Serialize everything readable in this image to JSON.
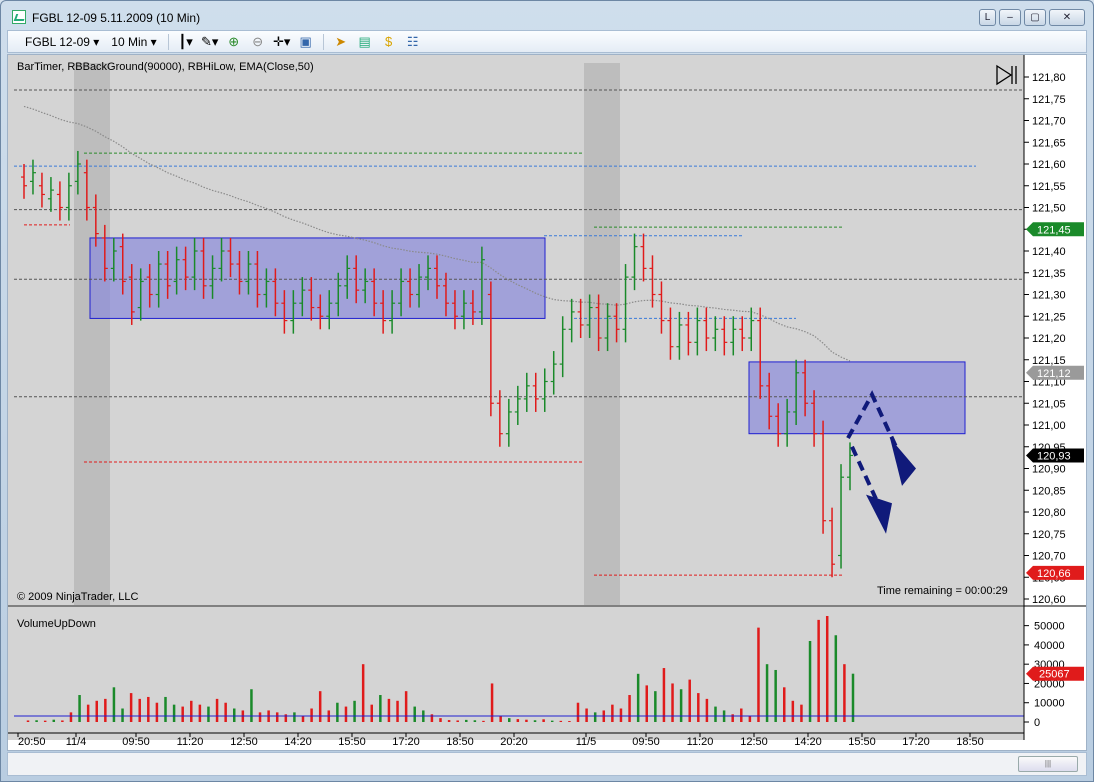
{
  "window": {
    "title": "FGBL 12-09  5.11.2009 (10 Min)",
    "buttons": [
      "L",
      "–",
      "▢",
      "✕"
    ]
  },
  "toolbar": {
    "instrument": "FGBL 12-09",
    "interval": "10 Min"
  },
  "price_panel": {
    "indicator_label": "BarTimer, RBBackGround(90000), RBHiLow, EMA(Close,50)",
    "copyright": "© 2009 NinjaTrader, LLC",
    "time_remaining": "Time remaining = 00:00:29",
    "y_ticks": [
      "121,80",
      "121,75",
      "121,70",
      "121,65",
      "121,60",
      "121,55",
      "121,50",
      "121,45",
      "121,40",
      "121,35",
      "121,30",
      "121,25",
      "121,20",
      "121,15",
      "121,10",
      "121,05",
      "121,00",
      "120,95",
      "120,90",
      "120,85",
      "120,80",
      "120,75",
      "120,70",
      "120,65",
      "120,60"
    ],
    "markers": [
      {
        "label": "121,45",
        "color": "#1a8a2a"
      },
      {
        "label": "121,12",
        "color": "#9a9a9a"
      },
      {
        "label": "120,93",
        "color": "#000000"
      },
      {
        "label": "120,66",
        "color": "#e01b1b"
      }
    ]
  },
  "volume_panel": {
    "label": "VolumeUpDown",
    "y_ticks": [
      "50000",
      "40000",
      "30000",
      "20000",
      "10000",
      "0"
    ],
    "marker": {
      "label": "25067",
      "color": "#e01b1b"
    }
  },
  "x_ticks": [
    "20:50",
    "11/4",
    "09:50",
    "11:20",
    "12:50",
    "14:20",
    "15:50",
    "17:20",
    "18:50",
    "20:20",
    "11/5",
    "09:50",
    "11:20",
    "12:50",
    "14:20",
    "15:50",
    "17:20",
    "18:50"
  ],
  "colors": {
    "up": "#1a8a2a",
    "down": "#e01b1b",
    "box": "#8c8cdc",
    "arrow": "#101a7a"
  }
}
